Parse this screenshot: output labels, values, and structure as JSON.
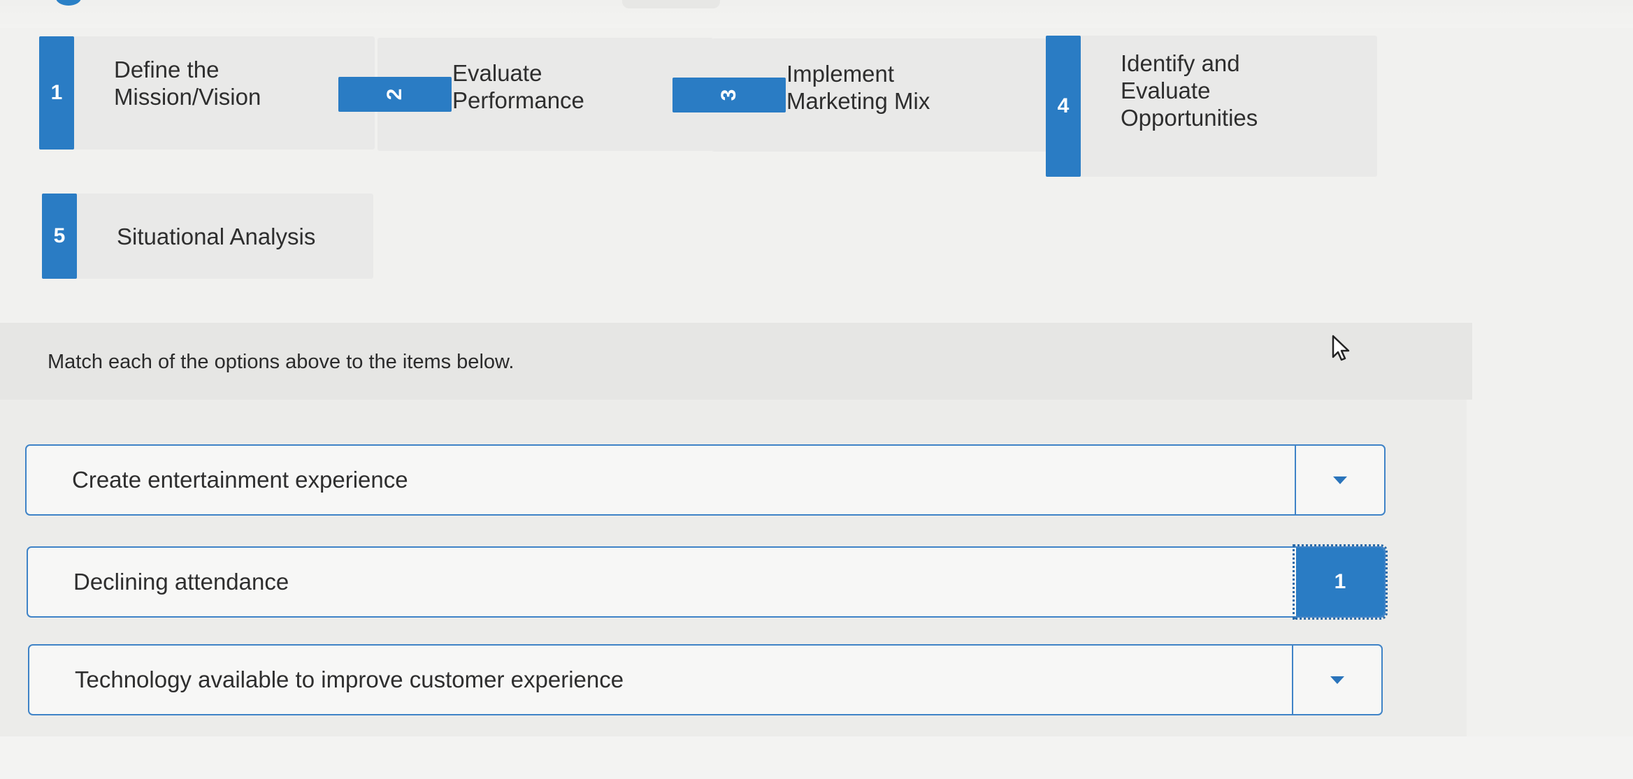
{
  "options": [
    {
      "number": "1",
      "label": "Define the Mission/Vision"
    },
    {
      "number": "2",
      "label": "Evaluate Performance"
    },
    {
      "number": "3",
      "label": "Implement Marketing Mix"
    },
    {
      "number": "4",
      "label": "Identify and Evaluate Opportunities"
    },
    {
      "number": "5",
      "label": "Situational Analysis"
    }
  ],
  "instructions": "Match each of the options above to the items below.",
  "items": [
    {
      "label": "Create entertainment experience",
      "selected": ""
    },
    {
      "label": "Declining attendance",
      "selected": "1"
    },
    {
      "label": "Technology available to improve customer experience",
      "selected": ""
    }
  ],
  "icons": {
    "caret": "chevron-down-icon",
    "cursor": "mouse-pointer-icon"
  },
  "colors": {
    "accent": "#2a7cc4",
    "border": "#3f83c7"
  }
}
